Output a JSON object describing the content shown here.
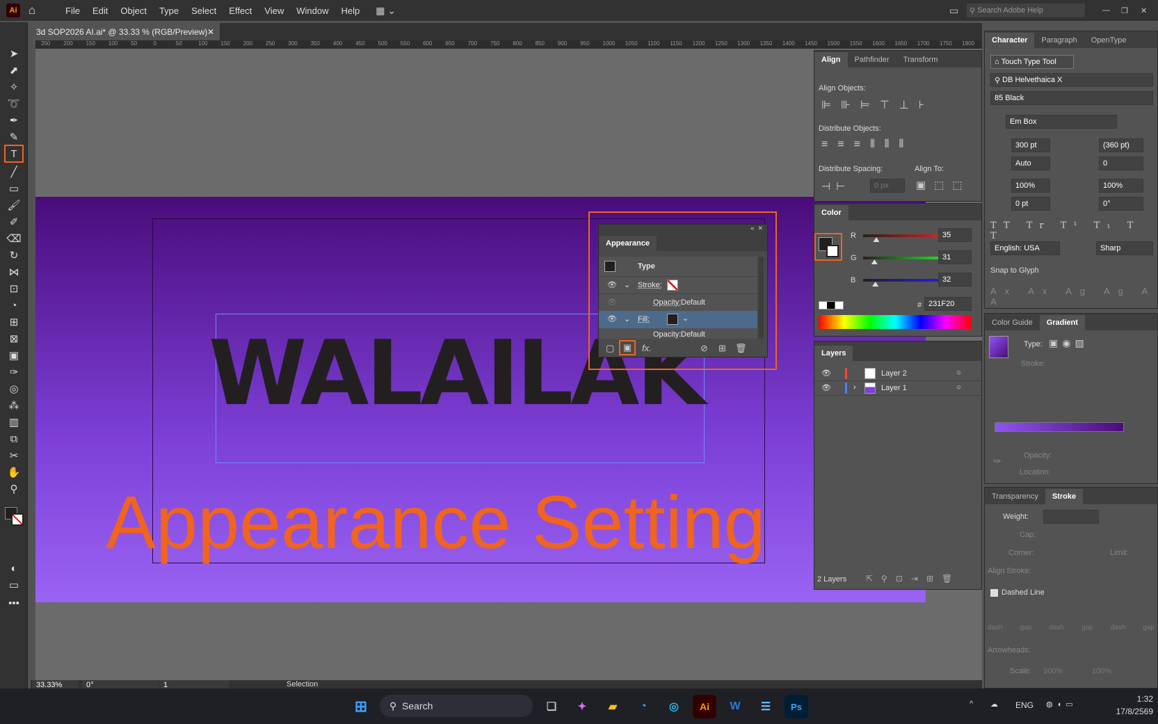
{
  "app": {
    "logo": "Ai",
    "menu": [
      "File",
      "Edit",
      "Object",
      "Type",
      "Select",
      "Effect",
      "View",
      "Window",
      "Help"
    ],
    "search_placeholder": "Search Adobe Help"
  },
  "document": {
    "tab_title": "3d SOP2026 AI.ai* @ 33.33 % (RGB/Preview)"
  },
  "ruler": [
    "250",
    "200",
    "150",
    "100",
    "50",
    "0",
    "50",
    "100",
    "150",
    "200",
    "250",
    "300",
    "350",
    "400",
    "450",
    "500",
    "550",
    "600",
    "650",
    "700",
    "750",
    "800",
    "850",
    "900",
    "950",
    "1000",
    "1050",
    "1100",
    "1150",
    "1200",
    "1250",
    "1300",
    "1350",
    "1400",
    "1450",
    "1500",
    "1550",
    "1600",
    "1650",
    "1700",
    "1750",
    "1800"
  ],
  "canvas": {
    "headline": "WALAILAK",
    "caption": "Appearance Setting",
    "caption_color": "#f0641e"
  },
  "status": {
    "zoom": "33.33%",
    "rotation": "0°",
    "artboard": "1",
    "tool": "Selection"
  },
  "align_panel": {
    "tabs": [
      "Align",
      "Pathfinder",
      "Transform"
    ],
    "align_objects": "Align Objects:",
    "distribute_objects": "Distribute Objects:",
    "distribute_spacing": "Distribute Spacing:",
    "align_to": "Align To:",
    "spacing_value": "0 px"
  },
  "color_panel": {
    "title": "Color",
    "r_label": "R",
    "g_label": "G",
    "b_label": "B",
    "r": "35",
    "g": "31",
    "b": "32",
    "r_pct": 0.14,
    "g_pct": 0.12,
    "b_pct": 0.13,
    "hex_label": "#",
    "hex": "231F20"
  },
  "appearance_panel": {
    "title": "Appearance",
    "type_label": "Type",
    "stroke_label": "Stroke:",
    "opacity_label": "Opacity:",
    "opacity_value": "Default",
    "fill_label": "Fill:",
    "opacity2_label": "Opacity:",
    "opacity2_value": "Default",
    "fx": "fx."
  },
  "layers_panel": {
    "title": "Layers",
    "layers": [
      {
        "name": "Layer 2",
        "color": "#ff4040"
      },
      {
        "name": "Layer 1",
        "color": "#4f7fff"
      }
    ],
    "count": "2 Layers"
  },
  "character_panel": {
    "tabs": [
      "Character",
      "Paragraph",
      "OpenType"
    ],
    "touch_type": "Touch Type Tool",
    "font_family": "DB Helvethaica X",
    "font_style": "85 Black",
    "em_box": "Em Box",
    "font_size": "300 pt",
    "leading": "(360 pt)",
    "kerning": "Auto",
    "tracking": "0",
    "vscale": "100%",
    "hscale": "100%",
    "baseline": "0 pt",
    "rotation": "0°",
    "language": "English: USA",
    "antialias": "Sharp",
    "snap_to_glyph": "Snap to Glyph"
  },
  "gradient_panel": {
    "tabs": [
      "Color Guide",
      "Gradient"
    ],
    "type_label": "Type:",
    "stroke_label": "Stroke:",
    "opacity_label": "Opacity:",
    "location_label": "Location:",
    "start": "#8f55f0",
    "end": "#4a0c7a"
  },
  "stroke_panel": {
    "tabs": [
      "Transparency",
      "Stroke"
    ],
    "weight": "Weight:",
    "cap": "Cap:",
    "corner": "Corner:",
    "limit": "Limit:",
    "align_stroke": "Align Stroke:",
    "dashed_line": "Dashed Line",
    "dash_labels": [
      "dash",
      "gap",
      "dash",
      "gap",
      "dash",
      "gap"
    ],
    "arrowheads": "Arrowheads:",
    "scale": "Scale:",
    "scale_value": "100%"
  },
  "taskbar": {
    "search": "Search",
    "lang": "ENG",
    "time": "1:32",
    "date": "17/8/2569"
  }
}
